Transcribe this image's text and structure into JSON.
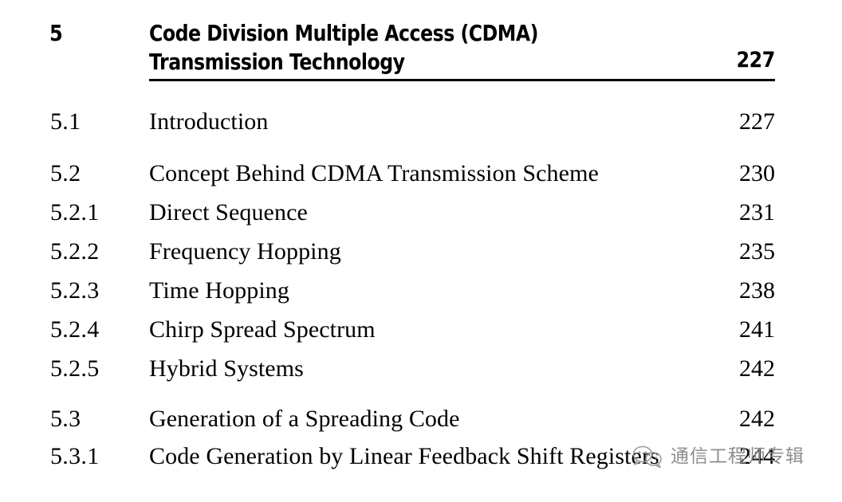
{
  "document": {
    "type": "book-table-of-contents",
    "background_color": "#ffffff",
    "text_color": "#000000"
  },
  "chapter": {
    "number": "5",
    "title_line_1": "Code Division Multiple Access (CDMA)",
    "title_line_2": "Transmission Technology",
    "page": "227"
  },
  "entries": [
    {
      "number": "5.1",
      "title": "Introduction",
      "page": "227"
    },
    {
      "number": "5.2",
      "title": "Concept Behind CDMA Transmission Scheme",
      "page": "230"
    },
    {
      "number": "5.2.1",
      "title": "Direct Sequence",
      "page": "231"
    },
    {
      "number": "5.2.2",
      "title": "Frequency Hopping",
      "page": "235"
    },
    {
      "number": "5.2.3",
      "title": "Time Hopping",
      "page": "238"
    },
    {
      "number": "5.2.4",
      "title": "Chirp Spread Spectrum",
      "page": "241"
    },
    {
      "number": "5.2.5",
      "title": "Hybrid Systems",
      "page": "242"
    },
    {
      "number": "5.3",
      "title": "Generation of a Spreading Code",
      "page": "242"
    },
    {
      "number": "5.3.1",
      "title": "Code Generation by Linear Feedback Shift Registers",
      "page": "244"
    }
  ],
  "watermark": {
    "logo_name": "wechat-speech-bubbles-icon",
    "text": "通信工程师专辑",
    "color": "#8d8d8d"
  }
}
